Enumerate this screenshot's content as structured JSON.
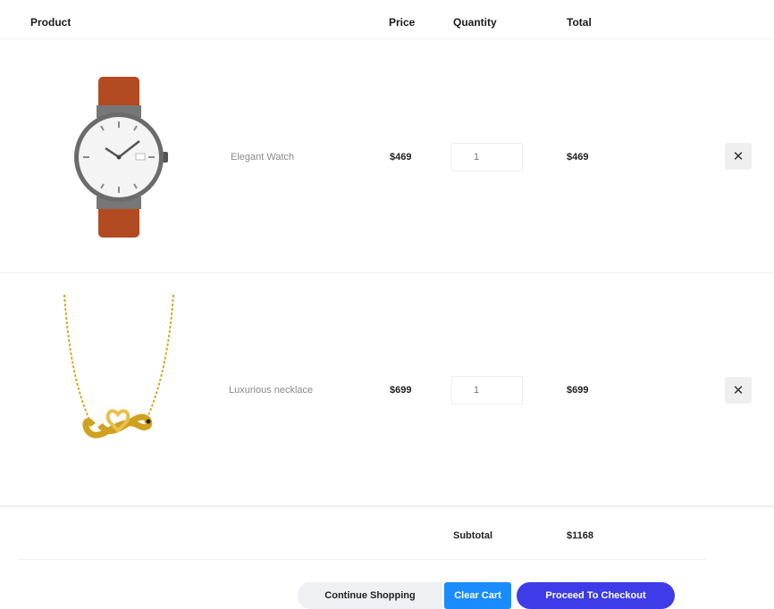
{
  "header": {
    "product": "Product",
    "price": "Price",
    "quantity": "Quantity",
    "total": "Total"
  },
  "items": [
    {
      "name": "Elegant Watch",
      "price": "$469",
      "quantity": "1",
      "total": "$469",
      "remove_label": "✕",
      "image_icon": "wristwatch-image",
      "colors": {
        "strap": "#b24a22",
        "case": "#6b6b6b",
        "dial": "#f4f4f4"
      }
    },
    {
      "name": "Luxurious necklace",
      "price": "$699",
      "quantity": "1",
      "total": "$699",
      "remove_label": "✕",
      "image_icon": "necklace-image",
      "colors": {
        "gold": "#d6a92a"
      }
    }
  ],
  "summary": {
    "subtotal_label": "Subtotal",
    "subtotal_value": "$1168"
  },
  "actions": {
    "continue_label": "Continue Shopping",
    "clear_label": "Clear Cart",
    "checkout_label": "Proceed To Checkout"
  },
  "colors": {
    "clear_button": "#1a8cff",
    "checkout_button": "#3d3ce8",
    "continue_button": "#eef0f3"
  }
}
